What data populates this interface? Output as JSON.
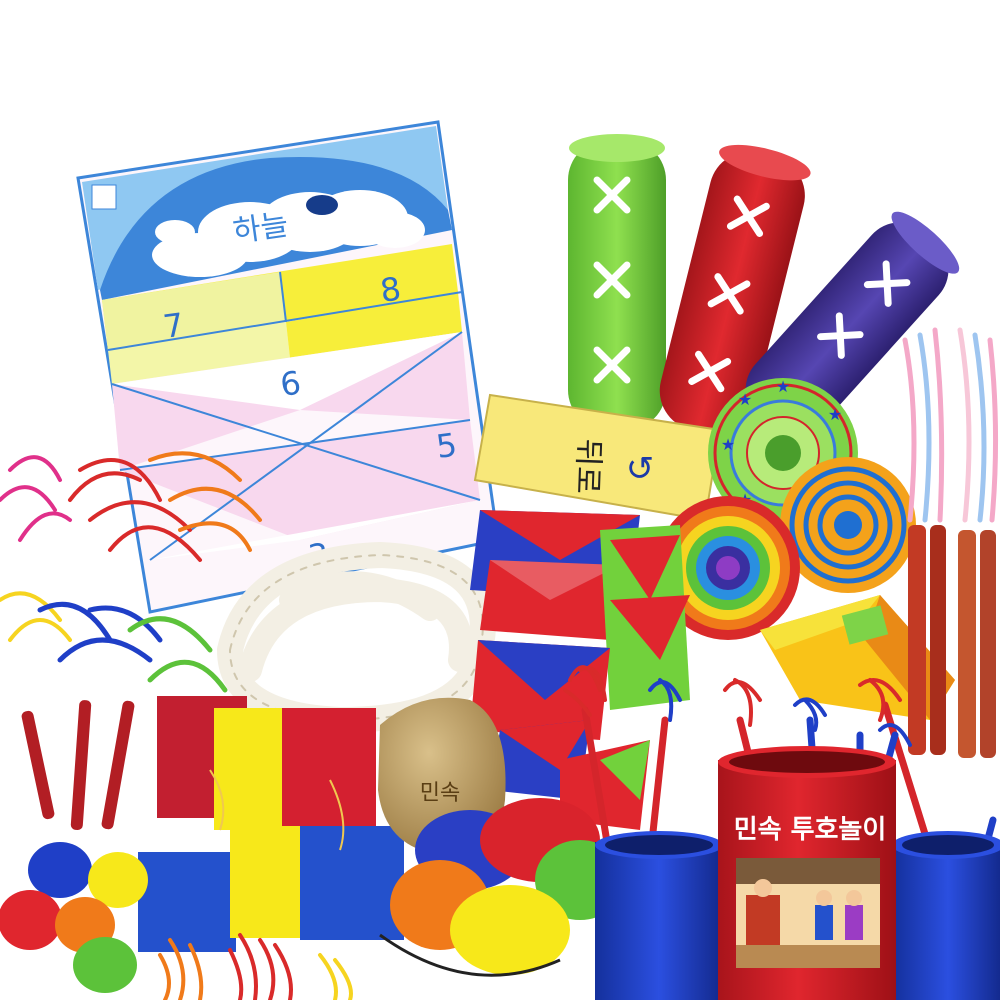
{
  "board": {
    "sky_label": "하늘",
    "num7": "7",
    "num8": "8",
    "num6": "6",
    "num5": "5",
    "num3": "3"
  },
  "paddle_label": "뒤로",
  "bag_label": "민속",
  "can": {
    "title": "민속 투호놀이"
  },
  "colors": {
    "sky_blue": "#3d86d9",
    "board_yellow": "#f7ee3a",
    "stick_green": "#7ed348",
    "stick_red": "#d4252b",
    "stick_purple": "#4a3a9c",
    "can_red": "#d9232c",
    "can_blue": "#1f3fc7"
  }
}
